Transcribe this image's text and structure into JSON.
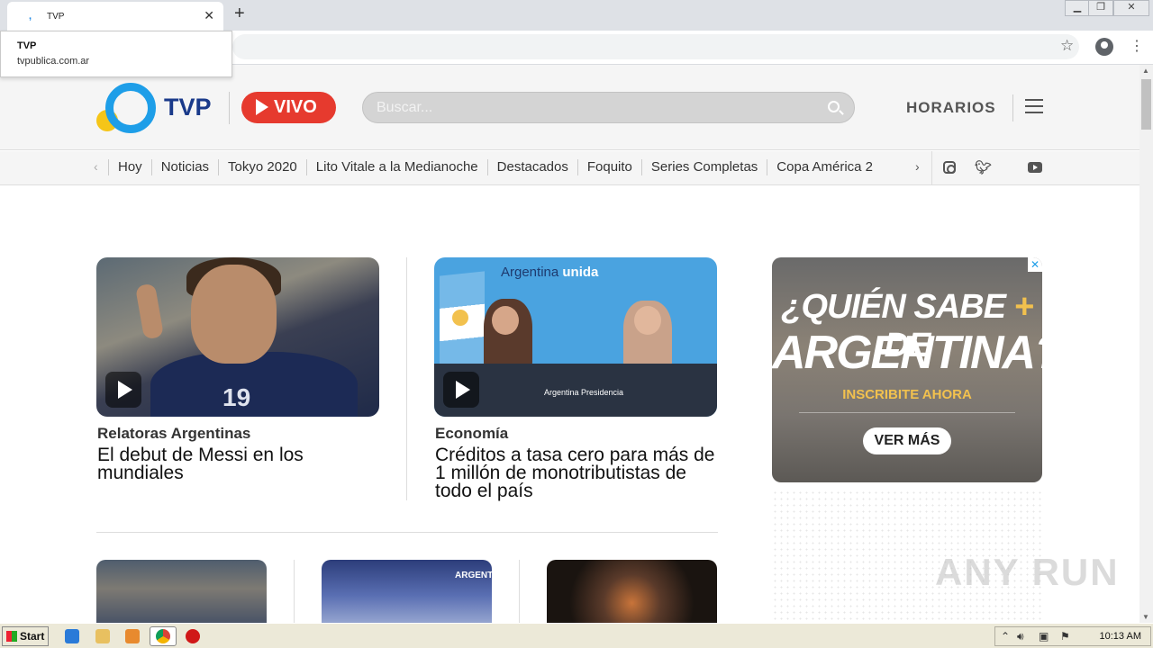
{
  "browser": {
    "tab_title": "TVP",
    "new_tab": "+",
    "close_tab": "✕",
    "tooltip_title": "TVP",
    "tooltip_url": "tvpublica.com.ar",
    "win_min": "▁",
    "win_max": "❐",
    "win_close": "✕"
  },
  "header": {
    "logo_text": "TVP",
    "vivo_label": "VIVO",
    "search_placeholder": "Buscar...",
    "horarios": "HORARIOS"
  },
  "nav": {
    "items": [
      "Hoy",
      "Noticias",
      "Tokyo 2020",
      "Lito Vitale a la Medianoche",
      "Destacados",
      "Foquito",
      "Series Completas",
      "Copa América 2"
    ]
  },
  "cards": [
    {
      "kicker": "Relatoras Argentinas",
      "headline": "El debut de Messi en los mundiales",
      "jersey_number": "19"
    },
    {
      "kicker": "Economía",
      "headline": "Créditos a tasa cero para más de 1 millón de monotributistas de todo el país",
      "banner_1": "Argentina",
      "banner_2": "unida",
      "table_label": "Argentina Presidencia"
    }
  ],
  "ad": {
    "line1_a": "¿QUIÉN SABE",
    "line1_plus": "+",
    "line1_b": "DE",
    "line2": "ARGENTINA?",
    "cta_text": "INSCRIBITE AHORA",
    "button": "VER MÁS",
    "close": "✕"
  },
  "row2": {
    "arg_text": "ARGENTINA"
  },
  "watermark": "ANY RUN",
  "taskbar": {
    "start": "Start",
    "clock": "10:13 AM"
  },
  "colors": {
    "accent_blue": "#1e9ee8",
    "vivo_red": "#e63a2e",
    "logo_yellow": "#f5c518",
    "logo_navy": "#1a3a8a"
  }
}
